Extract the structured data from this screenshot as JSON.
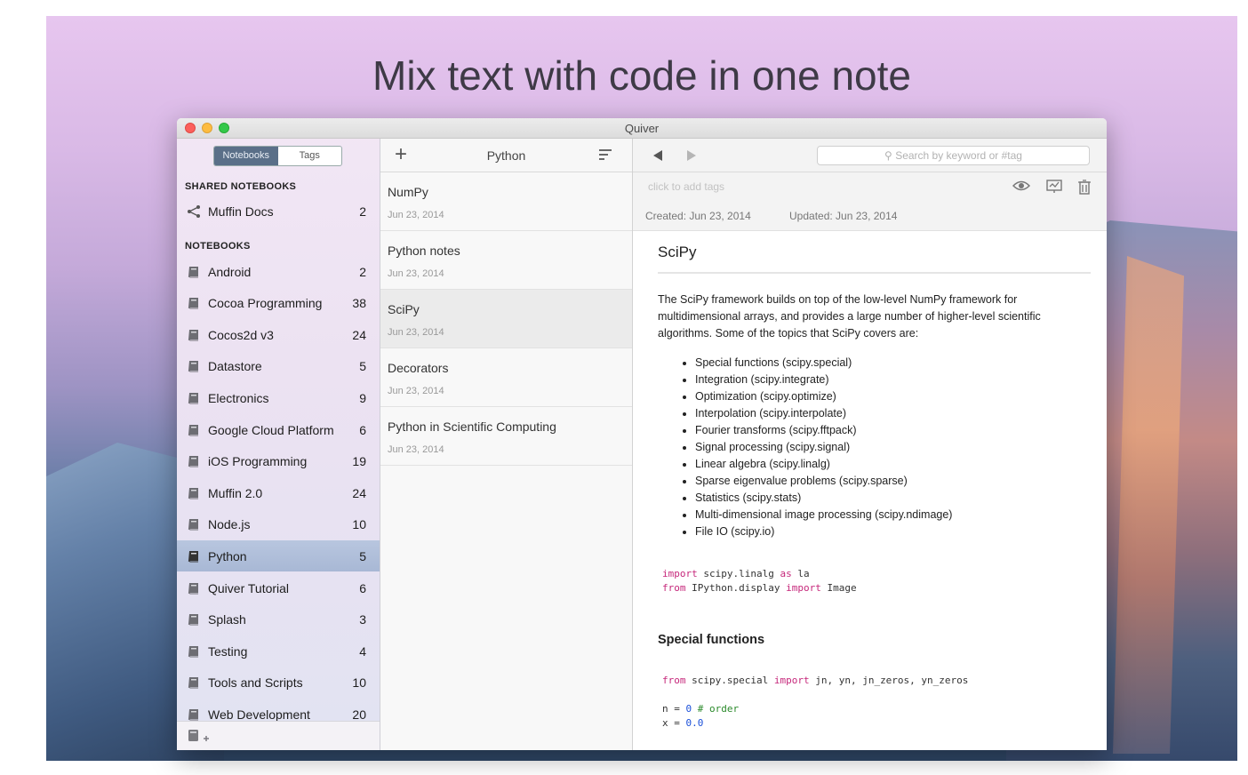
{
  "headline": "Mix text with code in one note",
  "window": {
    "title": "Quiver"
  },
  "sidebar": {
    "tabs": [
      "Notebooks",
      "Tags"
    ],
    "shared_header": "SHARED NOTEBOOKS",
    "shared": [
      {
        "label": "Muffin Docs",
        "count": "2"
      }
    ],
    "notebooks_header": "NOTEBOOKS",
    "notebooks": [
      {
        "label": "Android",
        "count": "2"
      },
      {
        "label": "Cocoa Programming",
        "count": "38"
      },
      {
        "label": "Cocos2d v3",
        "count": "24"
      },
      {
        "label": "Datastore",
        "count": "5"
      },
      {
        "label": "Electronics",
        "count": "9"
      },
      {
        "label": "Google Cloud Platform",
        "count": "6"
      },
      {
        "label": "iOS Programming",
        "count": "19"
      },
      {
        "label": "Muffin 2.0",
        "count": "24"
      },
      {
        "label": "Node.js",
        "count": "10"
      },
      {
        "label": "Python",
        "count": "5",
        "selected": true
      },
      {
        "label": "Quiver Tutorial",
        "count": "6"
      },
      {
        "label": "Splash",
        "count": "3"
      },
      {
        "label": "Testing",
        "count": "4"
      },
      {
        "label": "Tools and Scripts",
        "count": "10"
      },
      {
        "label": "Web Development",
        "count": "20"
      }
    ]
  },
  "note_list": {
    "title": "Python",
    "notes": [
      {
        "title": "NumPy",
        "date": "Jun 23, 2014"
      },
      {
        "title": "Python notes",
        "date": "Jun 23, 2014"
      },
      {
        "title": "SciPy",
        "date": "Jun 23, 2014",
        "selected": true
      },
      {
        "title": "Decorators",
        "date": "Jun 23, 2014"
      },
      {
        "title": "Python in Scientific Computing",
        "date": "Jun 23, 2014"
      }
    ]
  },
  "editor": {
    "search_placeholder": "Search by keyword or #tag",
    "tags_placeholder": "click to add tags",
    "created": "Created: Jun 23, 2014",
    "updated": "Updated: Jun 23, 2014",
    "doc_title": "SciPy",
    "intro": "The SciPy framework builds on top of the low-level NumPy framework for multidimensional arrays, and provides a large number of higher-level scientific algorithms. Some of the topics that SciPy covers are:",
    "topics": [
      "Special functions (scipy.special)",
      "Integration (scipy.integrate)",
      "Optimization (scipy.optimize)",
      "Interpolation (scipy.interpolate)",
      "Fourier transforms (scipy.fftpack)",
      "Signal processing (scipy.signal)",
      "Linear algebra (scipy.linalg)",
      "Sparse eigenvalue problems (scipy.sparse)",
      "Statistics (scipy.stats)",
      "Multi-dimensional image processing (scipy.ndimage)",
      "File IO (scipy.io)"
    ],
    "code1": [
      [
        {
          "t": "import",
          "k": "kw"
        },
        {
          "t": " scipy.linalg "
        },
        {
          "t": "as",
          "k": "kw"
        },
        {
          "t": " la"
        }
      ],
      [
        {
          "t": "from",
          "k": "kw"
        },
        {
          "t": " IPython.display "
        },
        {
          "t": "import",
          "k": "kw"
        },
        {
          "t": " Image"
        }
      ]
    ],
    "subheading": "Special functions",
    "code2": [
      [
        {
          "t": "from",
          "k": "kw"
        },
        {
          "t": " scipy.special "
        },
        {
          "t": "import",
          "k": "kw"
        },
        {
          "t": " jn, yn, jn_zeros, yn_zeros"
        }
      ],
      [
        {
          "t": ""
        }
      ],
      [
        {
          "t": "n = "
        },
        {
          "t": "0",
          "k": "num"
        },
        {
          "t": " "
        },
        {
          "t": "# order",
          "k": "cm"
        }
      ],
      [
        {
          "t": "x = "
        },
        {
          "t": "0.0",
          "k": "num"
        }
      ]
    ]
  }
}
